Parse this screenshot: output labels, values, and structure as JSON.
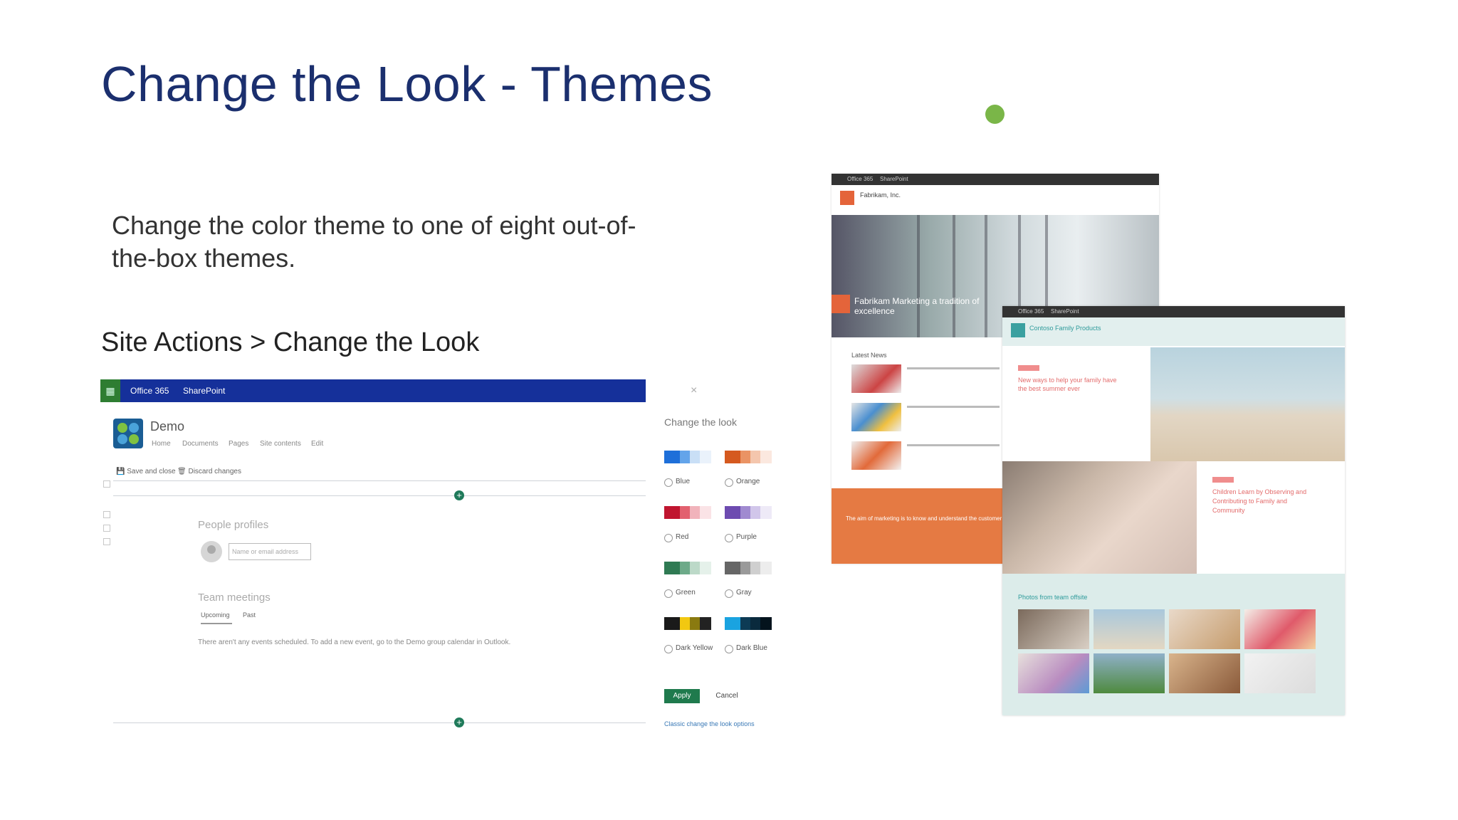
{
  "slide": {
    "title": "Change the Look - Themes",
    "body": "Change the color theme to one of eight out-of-the-box themes.",
    "path": "Site Actions > Change the Look"
  },
  "sharepoint": {
    "suite": {
      "app": "Office 365",
      "product": "SharePoint"
    },
    "site_name": "Demo",
    "nav": [
      "Home",
      "Documents",
      "Pages",
      "Site contents",
      "Edit"
    ],
    "commands": {
      "save": "Save and close",
      "discard": "Discard changes"
    },
    "people_heading": "People profiles",
    "people_placeholder": "Name or email address",
    "meetings_heading": "Team meetings",
    "meeting_tabs": [
      "Upcoming",
      "Past"
    ],
    "no_events": "There aren't any events scheduled. To add a new event, go to the Demo group calendar in Outlook."
  },
  "change_look": {
    "title": "Change the look",
    "themes": [
      {
        "label": "Blue",
        "colors": [
          "#1e6fd9",
          "#63a4ea",
          "#c9dff6",
          "#eaf2fb"
        ]
      },
      {
        "label": "Orange",
        "colors": [
          "#d5591f",
          "#ea9364",
          "#f4c6ad",
          "#fbe8df"
        ]
      },
      {
        "label": "Red",
        "colors": [
          "#c0152f",
          "#e2616f",
          "#f1b3bb",
          "#fae3e6"
        ]
      },
      {
        "label": "Purple",
        "colors": [
          "#6d4bb0",
          "#a08ad0",
          "#d1c6ea",
          "#eeeaf7"
        ]
      },
      {
        "label": "Green",
        "colors": [
          "#2f7a53",
          "#6daa89",
          "#bcd9c8",
          "#e5f1ea"
        ]
      },
      {
        "label": "Gray",
        "colors": [
          "#666666",
          "#9a9a9a",
          "#cfcfcf",
          "#ededed"
        ]
      },
      {
        "label": "Dark Yellow",
        "colors": [
          "#1a1a1a",
          "#f2c811",
          "#8a7a10",
          "#222222"
        ]
      },
      {
        "label": "Dark Blue",
        "colors": [
          "#1aa3e0",
          "#0d3b55",
          "#0a2a3d",
          "#04131d"
        ]
      }
    ],
    "apply": "Apply",
    "cancel": "Cancel",
    "classic_link": "Classic change the look options"
  },
  "fabrikam": {
    "suite": {
      "app": "Office 365",
      "product": "SharePoint"
    },
    "site_name": "Fabrikam, Inc.",
    "hero_text": "Fabrikam Marketing a tradition of excellence",
    "latest": "Latest News",
    "orange_text": "The aim of marketing is to know and understand the customer"
  },
  "contoso": {
    "suite": {
      "app": "Office 365",
      "product": "SharePoint"
    },
    "site_name": "Contoso Family Products",
    "card1": "New ways to help your family have the best summer ever",
    "card2": "Children Learn by Observing and Contributing to Family and Community",
    "photos_title": "Photos from team offsite"
  },
  "colors": {
    "title": "#1b2f6e",
    "suite_bar": "#15309a",
    "accent_green": "#7ab648",
    "fabrikam_orange": "#e57a43",
    "contoso_teal": "#3aa0a0"
  }
}
